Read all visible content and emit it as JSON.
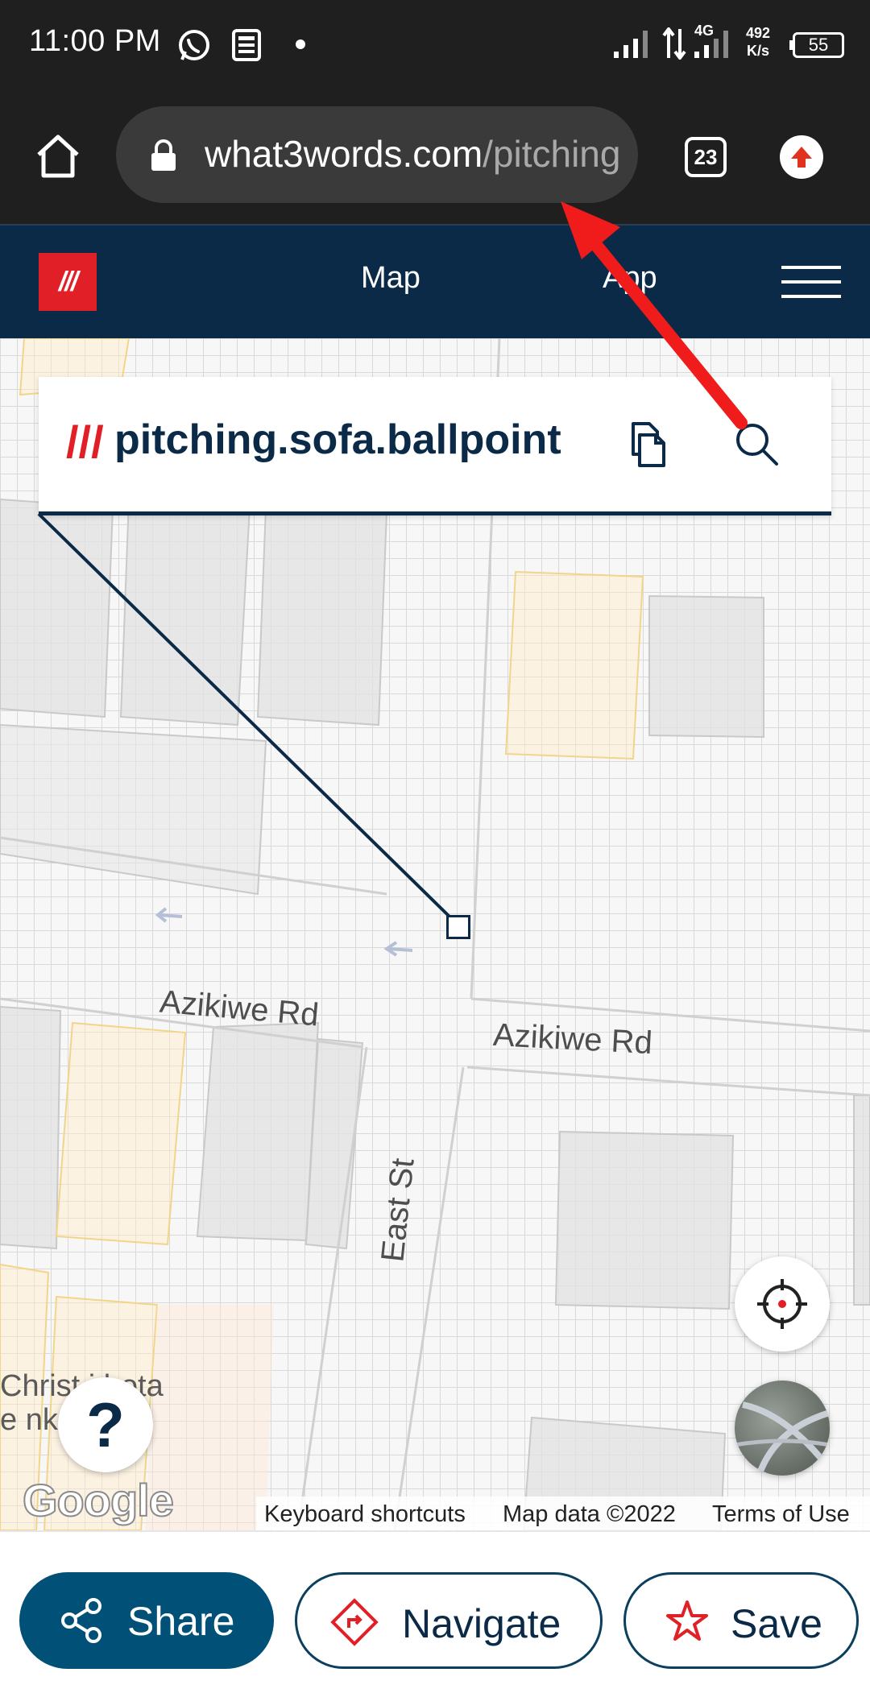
{
  "status_bar": {
    "time": "11:00 PM",
    "net_speed_value": "492",
    "net_speed_unit": "K/s",
    "network_type": "4G",
    "battery": "55",
    "icons": [
      "whatsapp-icon",
      "news-icon",
      "dot-icon",
      "signal-icon",
      "data-arrows-icon",
      "signal-icon",
      "battery-icon"
    ]
  },
  "browser": {
    "url_domain": "what3words.com",
    "url_path": "/pitching.sofa.ballpoint",
    "tab_count": "23",
    "icons": [
      "home-icon",
      "lock-icon",
      "update-icon"
    ]
  },
  "site_nav": {
    "logo_text": "///",
    "links": [
      "Map",
      "App"
    ],
    "brand_color": "#e11f26",
    "nav_color": "#0a2a47"
  },
  "address_card": {
    "slashes": "///",
    "words": "pitching.sofa.ballpoint"
  },
  "map": {
    "road_labels": [
      "Azikiwe Rd",
      "Azikiwe Rd",
      "East St"
    ],
    "place_label_line1": "Christ i bota",
    "place_label_line2": "e nke    twu",
    "google_logo": "Google",
    "attribution": [
      "Keyboard shortcuts",
      "Map data ©2022",
      "Terms of Use"
    ],
    "help_label": "?"
  },
  "actions": {
    "share_label": "Share",
    "navigate_label": "Navigate",
    "save_label": "Save",
    "accent_color": "#005078"
  }
}
